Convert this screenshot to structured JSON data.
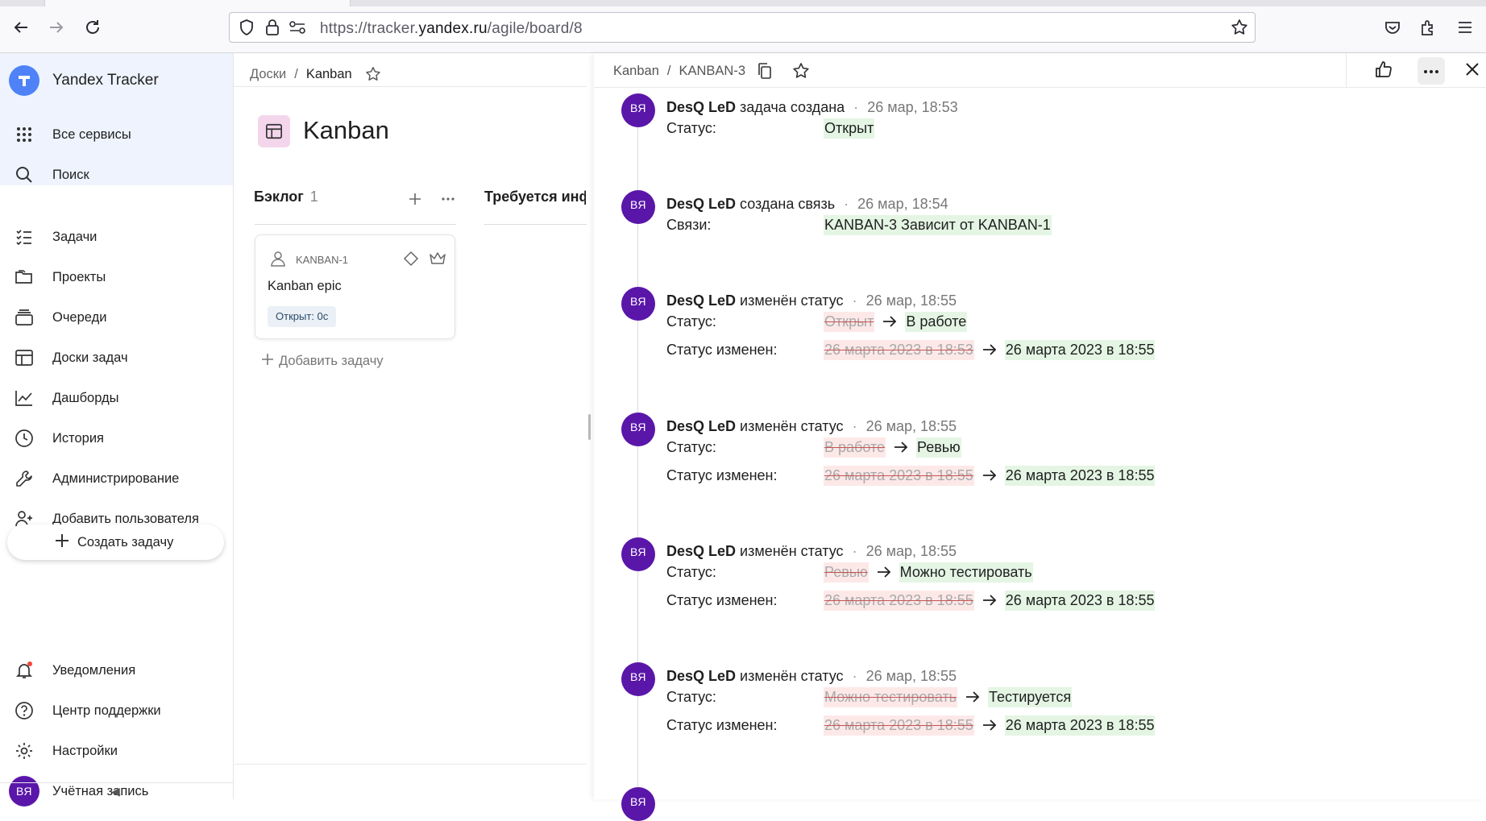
{
  "browser": {
    "url_prefix": "https://tracker.",
    "url_domain": "yandex.ru",
    "url_suffix": "/agile/board/8"
  },
  "sidebar": {
    "app_name": "Yandex Tracker",
    "top_items": [
      {
        "label": "Все сервисы"
      },
      {
        "label": "Поиск"
      }
    ],
    "items": [
      {
        "label": "Задачи"
      },
      {
        "label": "Проекты"
      },
      {
        "label": "Очереди"
      },
      {
        "label": "Доски задач"
      },
      {
        "label": "Дашборды"
      },
      {
        "label": "История"
      },
      {
        "label": "Администрирование"
      },
      {
        "label": "Добавить пользователя"
      }
    ],
    "create_label": "Создать задачу",
    "bottom_items": [
      {
        "label": "Уведомления"
      },
      {
        "label": "Центр поддержки"
      },
      {
        "label": "Настройки"
      },
      {
        "label": "Учётная запись"
      }
    ],
    "avatar_initials": "ВЯ"
  },
  "board": {
    "crumb_parent": "Доски",
    "crumb_sep": "/",
    "crumb_current": "Kanban",
    "title": "Kanban",
    "columns": [
      {
        "name": "Бэклог",
        "count": "1"
      },
      {
        "name": "Требуется инф"
      }
    ],
    "card": {
      "key": "KANBAN-1",
      "title": "Kanban epic",
      "badge": "Открыт: 0с"
    },
    "add_task_label": "Добавить задачу"
  },
  "panel": {
    "crumb_parent": "Kanban",
    "crumb_sep": "/",
    "crumb_current": "KANBAN-3",
    "entries": [
      {
        "initials": "ВЯ",
        "author": "DesQ LeD",
        "action": "задача создана",
        "time": "26 мар, 18:53",
        "rows": [
          {
            "label": "Статус:",
            "new": "Открыт"
          }
        ]
      },
      {
        "initials": "ВЯ",
        "author": "DesQ LeD",
        "action": "создана связь",
        "time": "26 мар, 18:54",
        "rows": [
          {
            "label": "Связи:",
            "new": "KANBAN-3 Зависит от KANBAN-1"
          }
        ]
      },
      {
        "initials": "ВЯ",
        "author": "DesQ LeD",
        "action": "изменён статус",
        "time": "26 мар, 18:55",
        "rows": [
          {
            "label": "Статус:",
            "old": "Открыт",
            "new": "В работе"
          },
          {
            "label": "Статус изменен:",
            "old": "26 марта 2023 в 18:53",
            "new": "26 марта 2023 в 18:55"
          }
        ]
      },
      {
        "initials": "ВЯ",
        "author": "DesQ LeD",
        "action": "изменён статус",
        "time": "26 мар, 18:55",
        "rows": [
          {
            "label": "Статус:",
            "old": "В работе",
            "new": "Ревью"
          },
          {
            "label": "Статус изменен:",
            "old": "26 марта 2023 в 18:55",
            "new": "26 марта 2023 в 18:55"
          }
        ]
      },
      {
        "initials": "ВЯ",
        "author": "DesQ LeD",
        "action": "изменён статус",
        "time": "26 мар, 18:55",
        "rows": [
          {
            "label": "Статус:",
            "old": "Ревью",
            "new": "Можно тестировать"
          },
          {
            "label": "Статус изменен:",
            "old": "26 марта 2023 в 18:55",
            "new": "26 марта 2023 в 18:55"
          }
        ]
      },
      {
        "initials": "ВЯ",
        "author": "DesQ LeD",
        "action": "изменён статус",
        "time": "26 мар, 18:55",
        "rows": [
          {
            "label": "Статус:",
            "old": "Можно тестировать",
            "new": "Тестируется"
          },
          {
            "label": "Статус изменен:",
            "old": "26 марта 2023 в 18:55",
            "new": "26 марта 2023 в 18:55"
          }
        ]
      },
      {
        "initials": "ВЯ"
      }
    ]
  },
  "colors": {
    "accent": "#4f82f7",
    "avatar": "#5a16a9",
    "old_bg": "#fde8e8",
    "new_bg": "#e4f5e4"
  }
}
